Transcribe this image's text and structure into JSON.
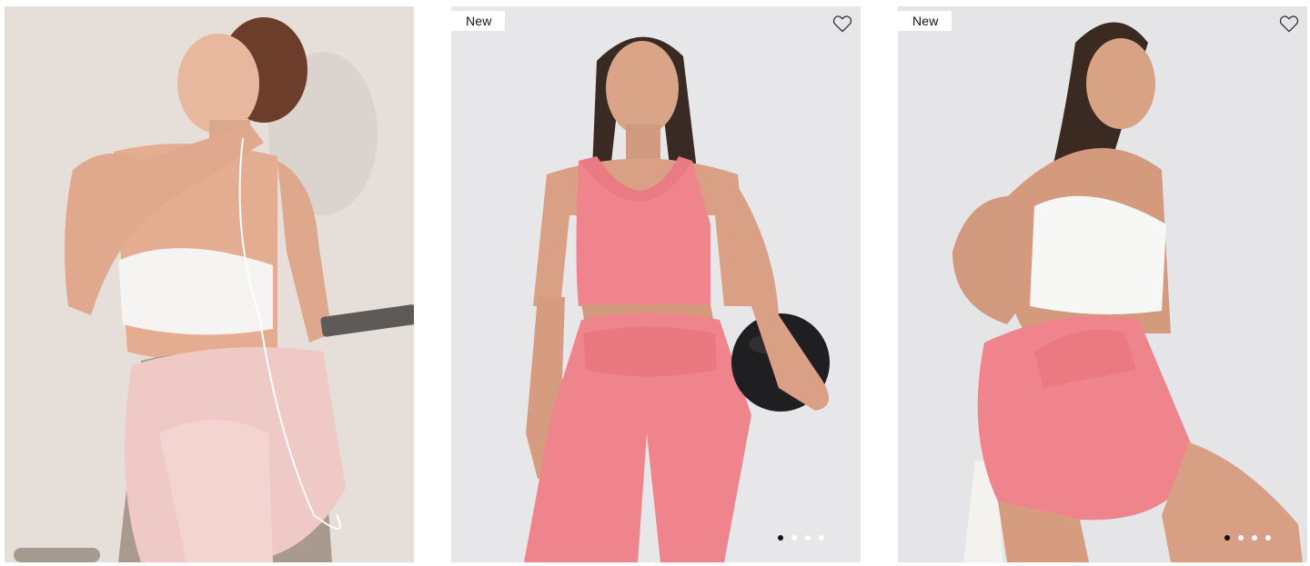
{
  "products": [
    {
      "image_alt": "model-in-white-ribbed-bra-and-taupe-leggings-with-pink-sweatshirt",
      "badge": "",
      "has_wishlist": false,
      "dots": []
    },
    {
      "image_alt": "model-in-pink-seamless-top-and-leggings-holding-medicine-ball",
      "badge": "New",
      "has_wishlist": true,
      "dots": [
        true,
        false,
        false,
        false
      ]
    },
    {
      "image_alt": "model-in-white-top-and-pink-shorts-rear-view",
      "badge": "New",
      "has_wishlist": true,
      "dots": [
        true,
        false,
        false,
        false
      ]
    }
  ],
  "colors": {
    "card1_background": "#e9e3de",
    "card2_background": "#e6e5e7",
    "card3_background": "#e4e4e6",
    "pink_garment": "#f0848c",
    "badge_background": "#ffffff",
    "active_dot": "#111111",
    "inactive_dot": "#ffffff"
  },
  "icons": {
    "wishlist": "heart-outline-icon"
  }
}
